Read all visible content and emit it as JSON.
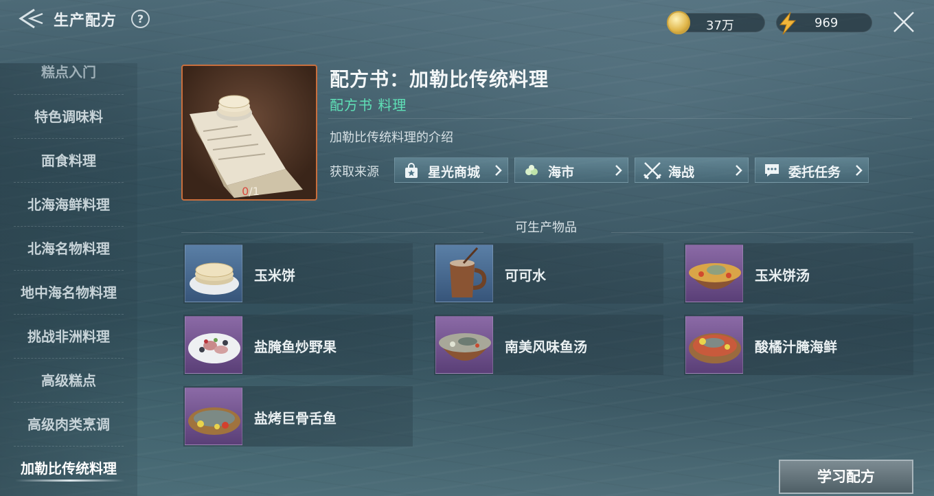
{
  "header": {
    "title": "生产配方",
    "help": "?",
    "gold_value": "37万",
    "energy_value": "969"
  },
  "sidebar": {
    "items": [
      {
        "label": "糕点入门"
      },
      {
        "label": "特色调味料"
      },
      {
        "label": "面食料理"
      },
      {
        "label": "北海海鲜料理"
      },
      {
        "label": "北海名物料理"
      },
      {
        "label": "地中海名物料理"
      },
      {
        "label": "挑战非洲料理"
      },
      {
        "label": "高级糕点"
      },
      {
        "label": "高级肉类烹调"
      },
      {
        "label": "加勒比传统料理"
      }
    ],
    "active_index": 9
  },
  "recipe": {
    "title": "配方书：加勒比传统料理",
    "type": "配方书 料理",
    "description": "加勒比传统料理的介绍",
    "owned": "0",
    "required": "/1",
    "source_label": "获取来源",
    "sources": [
      {
        "label": "星光商城",
        "icon": "shop-bag-icon"
      },
      {
        "label": "海市",
        "icon": "market-icon"
      },
      {
        "label": "海战",
        "icon": "crossed-swords-icon"
      },
      {
        "label": "委托任务",
        "icon": "chat-bubble-icon"
      }
    ]
  },
  "products": {
    "section_title": "可生产物品",
    "items": [
      {
        "name": "玉米饼",
        "rarity": "blue"
      },
      {
        "name": "可可水",
        "rarity": "blue"
      },
      {
        "name": "玉米饼汤",
        "rarity": "purple"
      },
      {
        "name": "盐腌鱼炒野果",
        "rarity": "purple"
      },
      {
        "name": "南美风味鱼汤",
        "rarity": "purple"
      },
      {
        "name": "酸橘汁腌海鲜",
        "rarity": "purple"
      },
      {
        "name": "盐烤巨骨舌鱼",
        "rarity": "purple"
      }
    ]
  },
  "actions": {
    "learn_label": "学习配方"
  },
  "colors": {
    "accent_green": "#5fe0b6",
    "frame_orange": "#c96f3e",
    "count_red": "#d94b41"
  }
}
